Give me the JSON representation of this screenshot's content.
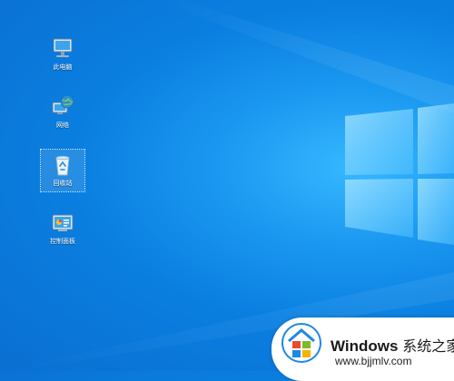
{
  "desktop_icons": [
    {
      "label": "此电脑",
      "icon": "computer-icon"
    },
    {
      "label": "网络",
      "icon": "network-icon"
    },
    {
      "label": "回收站",
      "icon": "recycle-bin-icon",
      "selected": true
    },
    {
      "label": "控制面板",
      "icon": "control-panel-icon"
    }
  ],
  "watermark": {
    "brand": "Windows",
    "suffix": "系统之家",
    "url": "www.bjjmlv.com",
    "logo_icon": "windows-flag-icon",
    "logo_colors": [
      "#e84a2f",
      "#7cbb2a",
      "#1e88e5",
      "#f5b400"
    ]
  },
  "colors": {
    "wallpaper_dark": "#0a6fd1",
    "wallpaper_light": "#36b8ff"
  }
}
